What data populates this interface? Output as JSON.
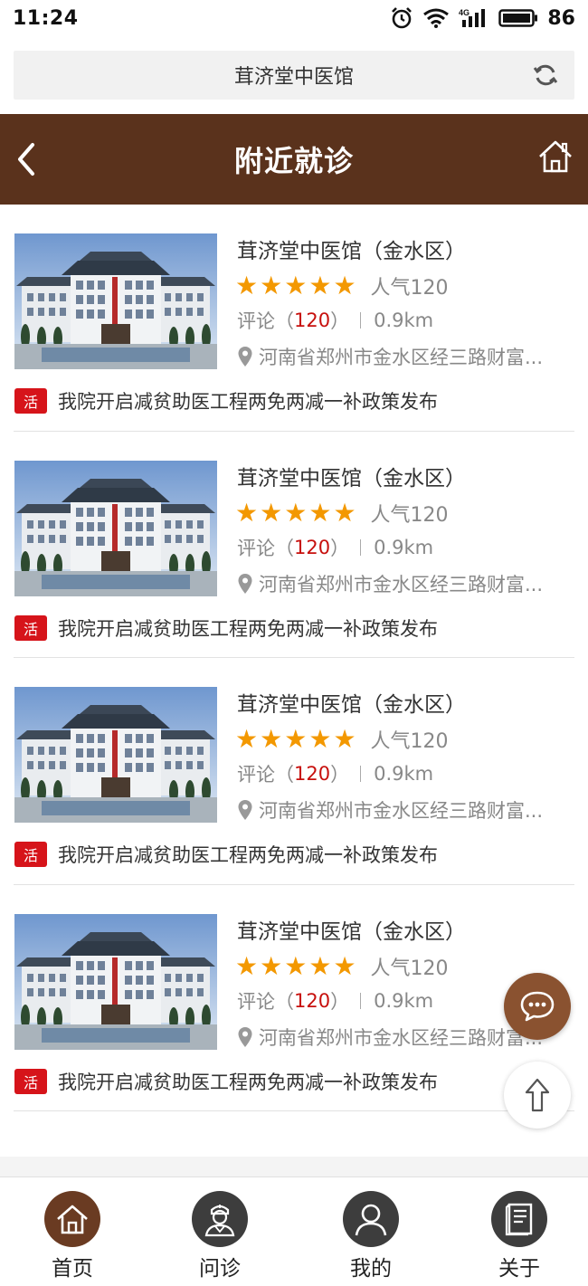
{
  "status_bar": {
    "time": "11:24",
    "battery": "86"
  },
  "browser": {
    "title": "茸济堂中医馆"
  },
  "header": {
    "title": "附近就诊"
  },
  "clinics": [
    {
      "name": "茸济堂中医馆（金水区）",
      "popularity": "人气120",
      "reviews_label": "评论（",
      "reviews_count": "120",
      "reviews_close": "）",
      "distance": "0.9km",
      "address": "河南省郑州市金水区经三路财富...",
      "promo_badge": "活",
      "promo_text": "我院开启减贫助医工程两免两减一补政策发布"
    },
    {
      "name": "茸济堂中医馆（金水区）",
      "popularity": "人气120",
      "reviews_label": "评论（",
      "reviews_count": "120",
      "reviews_close": "）",
      "distance": "0.9km",
      "address": "河南省郑州市金水区经三路财富...",
      "promo_badge": "活",
      "promo_text": "我院开启减贫助医工程两免两减一补政策发布"
    },
    {
      "name": "茸济堂中医馆（金水区）",
      "popularity": "人气120",
      "reviews_label": "评论（",
      "reviews_count": "120",
      "reviews_close": "）",
      "distance": "0.9km",
      "address": "河南省郑州市金水区经三路财富...",
      "promo_badge": "活",
      "promo_text": "我院开启减贫助医工程两免两减一补政策发布"
    },
    {
      "name": "茸济堂中医馆（金水区）",
      "popularity": "人气120",
      "reviews_label": "评论（",
      "reviews_count": "120",
      "reviews_close": "）",
      "distance": "0.9km",
      "address": "河南省郑州市金水区经三路财富...",
      "promo_badge": "活",
      "promo_text": "我院开启减贫助医工程两免两减一补政策发布"
    }
  ],
  "rating_stars": 5,
  "tabs": [
    {
      "label": "首页",
      "icon": "home-icon",
      "active": true
    },
    {
      "label": "问诊",
      "icon": "doctor-icon",
      "active": false
    },
    {
      "label": "我的",
      "icon": "user-icon",
      "active": false
    },
    {
      "label": "关于",
      "icon": "book-icon",
      "active": false
    }
  ],
  "colors": {
    "header_bg": "#5a321c",
    "star": "#f39800",
    "badge": "#d6141a",
    "accent_count": "#c7100d",
    "tab_active": "#6a3b22"
  }
}
